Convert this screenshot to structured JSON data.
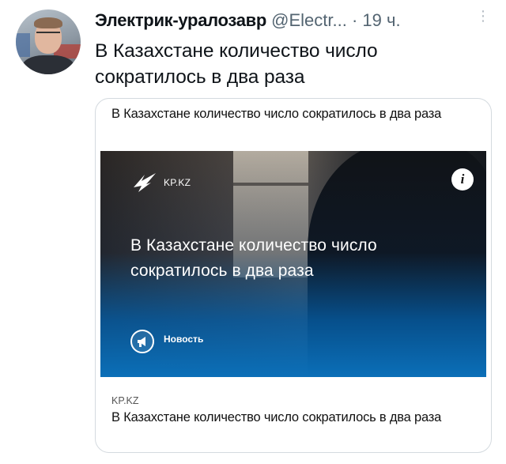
{
  "tweet": {
    "author": {
      "display_name": "Электрик-уралозавр",
      "handle": "@Electr..."
    },
    "separator": "·",
    "time": "19 ч.",
    "more_icon": "vertical-ellipsis",
    "text": "В Казахстане количество число сократилось в два раза"
  },
  "card": {
    "top_title": "В Казахстане количество число сократилось в два раза",
    "image": {
      "source_label": "KP.KZ",
      "logo_icon": "kp-kz-logo",
      "info_icon": "i",
      "headline": "В Казахстане количество число сократилось в два раза",
      "badge_icon": "megaphone",
      "badge_label": "Новость"
    },
    "domain": "KP.KZ",
    "bottom_title": "В Казахстане количество число сократилось в два раза"
  },
  "colors": {
    "text_primary": "#0f1419",
    "text_secondary": "#536471",
    "card_border": "#d4dadf",
    "image_blue": "#0b6fb8"
  }
}
